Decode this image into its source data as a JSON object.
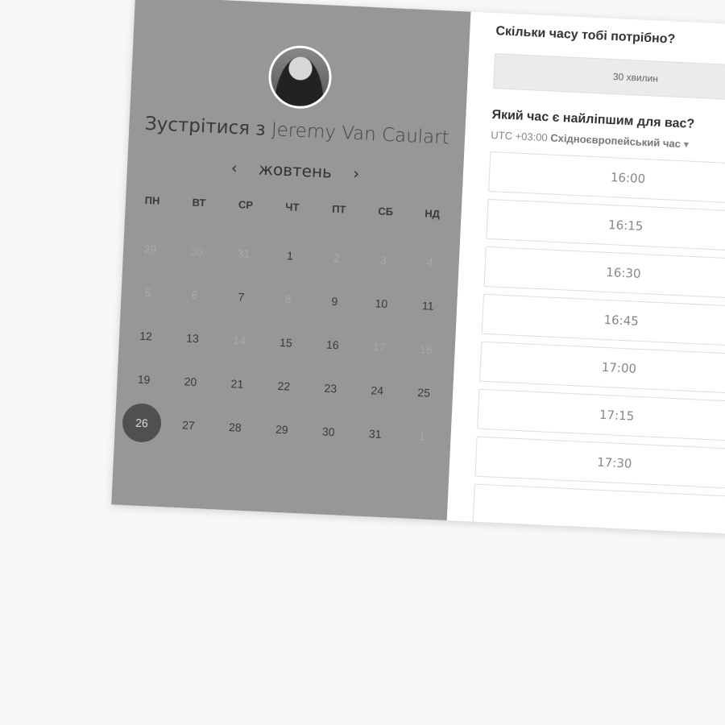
{
  "left": {
    "title_prefix": "Зустрітися з",
    "host_name": "Jeremy Van Caulart",
    "month": "жовтень",
    "prev": "‹",
    "next": "›",
    "weekdays": [
      "ПН",
      "ВТ",
      "СР",
      "ЧТ",
      "ПТ",
      "СБ",
      "НД"
    ],
    "days": [
      {
        "d": "29",
        "s": "off"
      },
      {
        "d": "30",
        "s": "off"
      },
      {
        "d": "31",
        "s": "off"
      },
      {
        "d": "1",
        "s": "on"
      },
      {
        "d": "2",
        "s": "off"
      },
      {
        "d": "3",
        "s": "off"
      },
      {
        "d": "4",
        "s": "off"
      },
      {
        "d": "5",
        "s": "off"
      },
      {
        "d": "6",
        "s": "off"
      },
      {
        "d": "7",
        "s": "on"
      },
      {
        "d": "8",
        "s": "off"
      },
      {
        "d": "9",
        "s": "on"
      },
      {
        "d": "10",
        "s": "on"
      },
      {
        "d": "11",
        "s": "on"
      },
      {
        "d": "12",
        "s": "on"
      },
      {
        "d": "13",
        "s": "on"
      },
      {
        "d": "14",
        "s": "off"
      },
      {
        "d": "15",
        "s": "on"
      },
      {
        "d": "16",
        "s": "on"
      },
      {
        "d": "17",
        "s": "off"
      },
      {
        "d": "18",
        "s": "off"
      },
      {
        "d": "19",
        "s": "on"
      },
      {
        "d": "20",
        "s": "on"
      },
      {
        "d": "21",
        "s": "on"
      },
      {
        "d": "22",
        "s": "on"
      },
      {
        "d": "23",
        "s": "on"
      },
      {
        "d": "24",
        "s": "on"
      },
      {
        "d": "25",
        "s": "on"
      },
      {
        "d": "26",
        "s": "sel"
      },
      {
        "d": "27",
        "s": "on"
      },
      {
        "d": "28",
        "s": "on"
      },
      {
        "d": "29",
        "s": "on"
      },
      {
        "d": "30",
        "s": "on"
      },
      {
        "d": "31",
        "s": "on"
      },
      {
        "d": "1",
        "s": "off"
      }
    ]
  },
  "right": {
    "duration_question": "Скільки часу тобі потрібно?",
    "duration_value": "30 хвилин",
    "time_question": "Який час є найліпшим для вас?",
    "tz_offset": "UTC +03:00",
    "tz_name": "Східноєвропейський час",
    "tz_caret": "▾",
    "slots": [
      "16:00",
      "16:15",
      "16:30",
      "16:45",
      "17:00",
      "17:15",
      "17:30",
      ""
    ]
  }
}
